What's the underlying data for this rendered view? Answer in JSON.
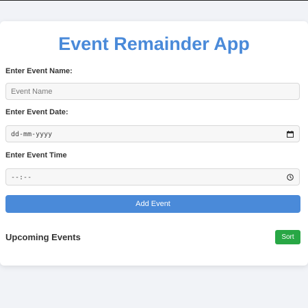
{
  "app": {
    "title": "Event Remainder App"
  },
  "form": {
    "name_label": "Enter Event Name:",
    "name_placeholder": "Event Name",
    "date_label": "Enter Event Date:",
    "date_placeholder": "dd-mm-yyyy",
    "time_label": "Enter Event Time",
    "time_placeholder": "--:--",
    "add_button": "Add Event"
  },
  "events": {
    "heading": "Upcoming Events",
    "sort_button": "Sort"
  },
  "icons": {
    "date": "calendar-icon",
    "time": "clock-icon"
  },
  "colors": {
    "accent": "#4a8ad9",
    "sort": "#28a745",
    "background": "#f1f3f7"
  }
}
